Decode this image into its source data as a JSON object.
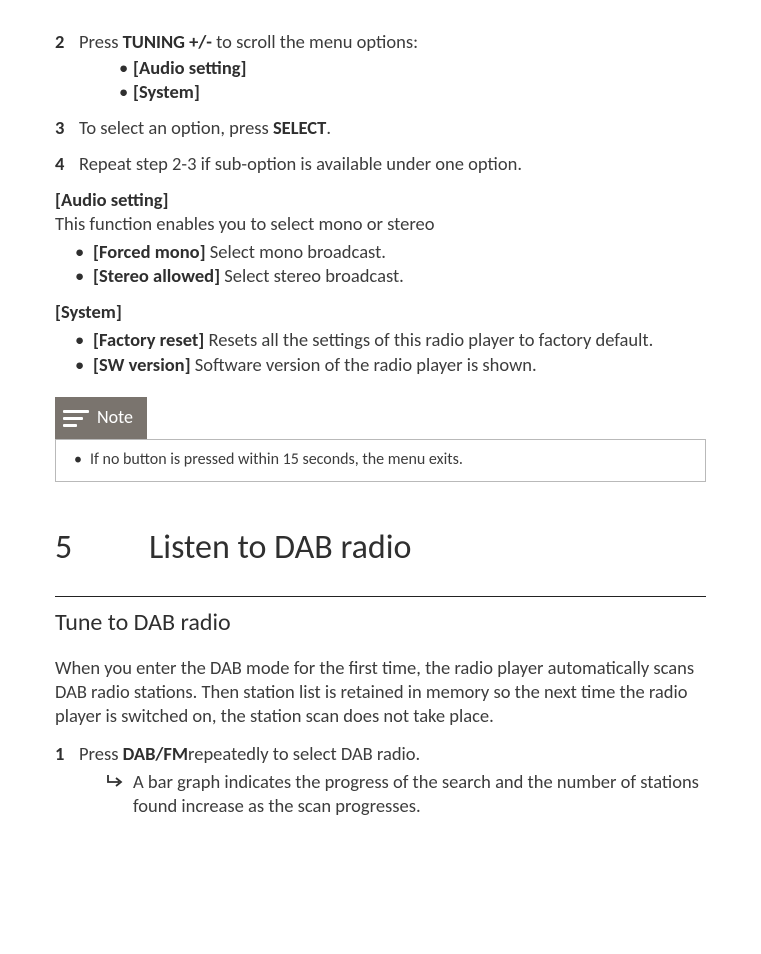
{
  "steps": {
    "s2": {
      "num": "2",
      "pre": "Press ",
      "bold": "TUNING +/-",
      "post": " to scroll the menu options:",
      "items": [
        "[Audio setting]",
        "[System]"
      ]
    },
    "s3": {
      "num": "3",
      "pre": "To select an option, press ",
      "bold": "SELECT",
      "post": "."
    },
    "s4": {
      "num": "4",
      "text": "Repeat step 2-3 if sub-option is available under one option."
    }
  },
  "audio": {
    "head": "[Audio setting]",
    "desc": "This function enables you to select mono or stereo",
    "i1b": "[Forced mono]",
    "i1t": " Select mono broadcast.",
    "i2b": "[Stereo allowed]",
    "i2t": " Select stereo broadcast."
  },
  "system": {
    "head": "[System]",
    "i1b": "[Factory reset]",
    "i1t": "  Resets all the settings of this radio player to factory default.",
    "i2b": "[SW version]",
    "i2t": "  Software version of the radio player is shown."
  },
  "note": {
    "label": "Note",
    "text": "If no button is pressed within 15 seconds, the menu exits."
  },
  "section5": {
    "num": "5",
    "title": "Listen to DAB radio",
    "sub": "Tune to DAB radio",
    "intro": "When you enter the DAB mode for the first time, the radio player automatically scans DAB radio stations. Then station list is retained in memory so the next time the radio player is switched on, the station scan does not take place.",
    "step1": {
      "num": "1",
      "pre": "Press ",
      "bold": "DAB/FM",
      "post": "repeatedly to select DAB radio.",
      "arrow": "A bar graph indicates the progress of the search and the number of stations found increase as the scan progresses."
    }
  }
}
